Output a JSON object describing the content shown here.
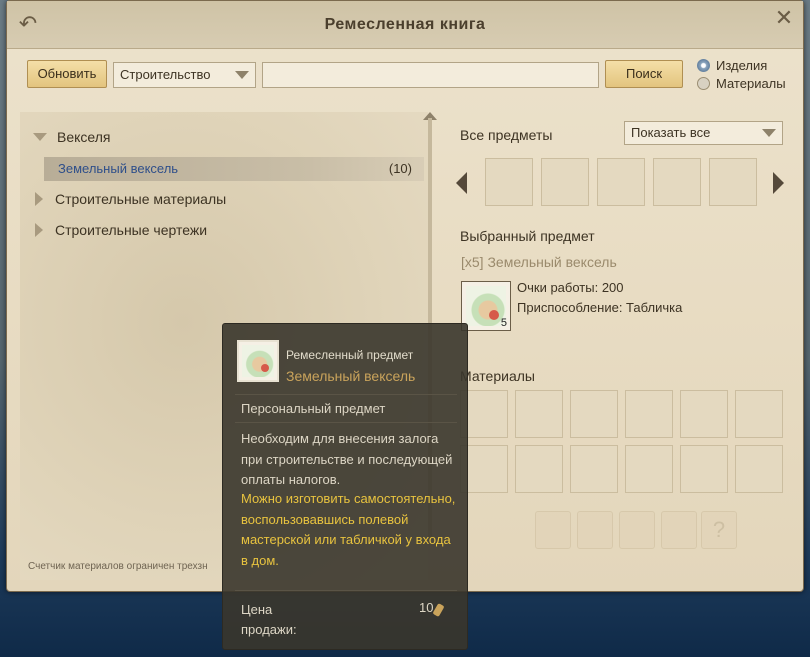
{
  "window": {
    "title": "Ремесленная книга"
  },
  "toolbar": {
    "refresh_label": "Обновить",
    "category_value": "Строительство",
    "search_value": "",
    "search_label": "Поиск",
    "radio_products": "Изделия",
    "radio_materials": "Материалы",
    "selected_radio": "Изделия"
  },
  "tree": {
    "groups": [
      {
        "label": "Векселя",
        "expanded": true
      },
      {
        "label": "Строительные материалы",
        "expanded": false
      },
      {
        "label": "Строительные чертежи",
        "expanded": false
      }
    ],
    "selected_item": {
      "label": "Земельный вексель",
      "count": "(10)"
    },
    "footnote": "Счетчик материалов ограничен трехзн"
  },
  "right": {
    "all_items_label": "Все предметы",
    "filter_value": "Показать все",
    "selected_label": "Выбранный предмет",
    "selected_name": "[x5] Земельный вексель",
    "selected_qty": "5",
    "work_points": "Очки работы: 200",
    "tool": "Приспособление: Табличка",
    "materials_label": "Материалы"
  },
  "tooltip": {
    "type": "Ремесленный предмет",
    "name": "Земельный вексель",
    "personal": "Персональный предмет",
    "description": "Необходим для внесения залога при строительстве и последующей оплаты налогов.",
    "note": "Можно изготовить самостоятельно, воспользовавшись полевой мастерской или табличкой у входа в дом.",
    "price_label": "Цена продажи:",
    "price_value": "10"
  },
  "colors": {
    "accent_link": "#2f4f8a",
    "tooltip_highlight": "#e8c33f",
    "tooltip_item_name": "#c9a35b"
  }
}
